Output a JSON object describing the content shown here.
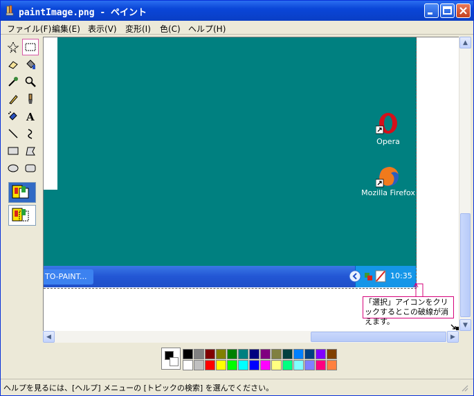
{
  "window": {
    "title": "paintImage.png - ペイント"
  },
  "menu": [
    {
      "label": "ファイル(F)"
    },
    {
      "label": "編集(E)"
    },
    {
      "label": "表示(V)"
    },
    {
      "label": "変形(I)"
    },
    {
      "label": "色(C)"
    },
    {
      "label": "ヘルプ(H)"
    }
  ],
  "tools": [
    "free-select",
    "rect-select",
    "eraser",
    "fill",
    "color-picker",
    "magnifier",
    "pencil",
    "brush",
    "airbrush",
    "text",
    "line",
    "curve",
    "rectangle",
    "polygon",
    "ellipse",
    "rounded-rectangle"
  ],
  "canvas": {
    "desktop_color": "#008080",
    "taskbar_button": "TO-PAINT...",
    "clock": "10:35",
    "icons": [
      {
        "label": "Opera"
      },
      {
        "label": "Mozilla Firefox"
      }
    ],
    "callout": "「選択」アイコンをクリックするとこの破線が消えます。"
  },
  "palette": {
    "primary": "#000000",
    "secondary": "#ffffff",
    "row1": [
      "#000000",
      "#808080",
      "#800000",
      "#808000",
      "#008000",
      "#008080",
      "#000080",
      "#800080",
      "#808040",
      "#004040",
      "#0080ff",
      "#004080",
      "#8000ff",
      "#804000"
    ],
    "row2": [
      "#ffffff",
      "#c0c0c0",
      "#ff0000",
      "#ffff00",
      "#00ff00",
      "#00ffff",
      "#0000ff",
      "#ff00ff",
      "#ffff80",
      "#00ff80",
      "#80ffff",
      "#8080ff",
      "#ff0080",
      "#ff8040"
    ]
  },
  "status": {
    "help_text": "ヘルプを見るには、[ヘルプ] メニューの [トピックの検索] を選んでください。"
  }
}
